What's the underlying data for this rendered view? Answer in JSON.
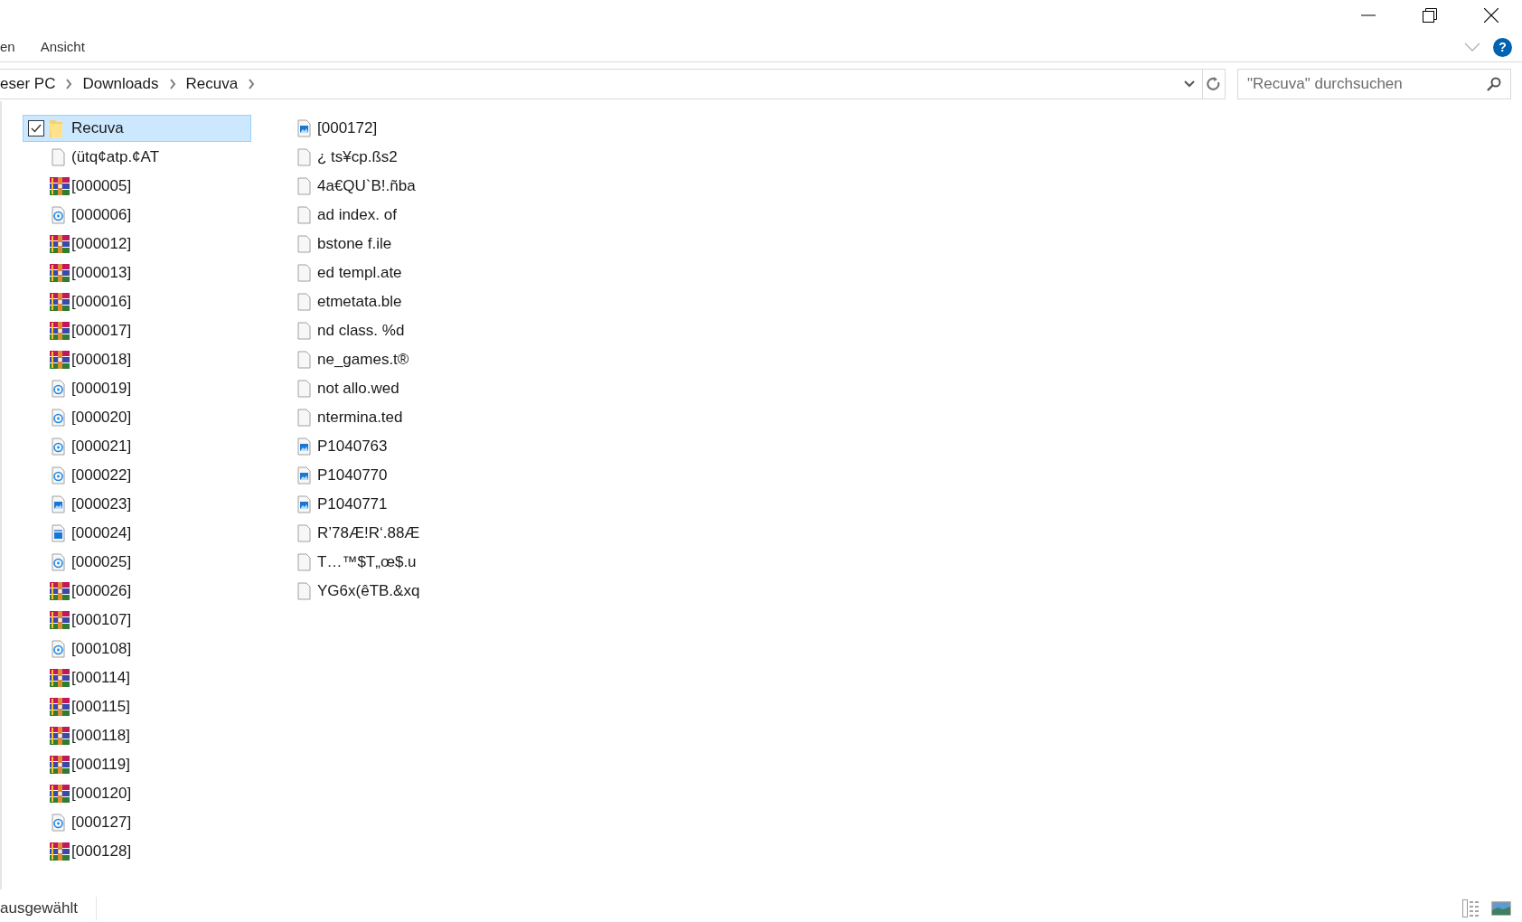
{
  "ribbon_tabs": [
    {
      "label": "en"
    },
    {
      "label": "Ansicht"
    }
  ],
  "help_button": {
    "label": "?"
  },
  "address_bar": {
    "breadcrumbs": [
      "eser PC",
      "Downloads",
      "Recuva"
    ]
  },
  "search": {
    "placeholder": "\"Recuva\" durchsuchen"
  },
  "items": [
    {
      "name": "Recuva",
      "kind": "folder",
      "selected": true,
      "checked": true
    },
    {
      "name": "(ütq¢atp.¢AT",
      "kind": "blank",
      "selected": false,
      "checked": false
    },
    {
      "name": "[000005]",
      "kind": "archive",
      "selected": false,
      "checked": false
    },
    {
      "name": "[000006]",
      "kind": "disc",
      "selected": false,
      "checked": false
    },
    {
      "name": "[000012]",
      "kind": "archive",
      "selected": false,
      "checked": false
    },
    {
      "name": "[000013]",
      "kind": "archive",
      "selected": false,
      "checked": false
    },
    {
      "name": "[000016]",
      "kind": "archive",
      "selected": false,
      "checked": false
    },
    {
      "name": "[000017]",
      "kind": "archive",
      "selected": false,
      "checked": false
    },
    {
      "name": "[000018]",
      "kind": "archive",
      "selected": false,
      "checked": false
    },
    {
      "name": "[000019]",
      "kind": "disc",
      "selected": false,
      "checked": false
    },
    {
      "name": "[000020]",
      "kind": "disc",
      "selected": false,
      "checked": false
    },
    {
      "name": "[000021]",
      "kind": "disc",
      "selected": false,
      "checked": false
    },
    {
      "name": "[000022]",
      "kind": "disc",
      "selected": false,
      "checked": false
    },
    {
      "name": "[000023]",
      "kind": "image",
      "selected": false,
      "checked": false
    },
    {
      "name": "[000024]",
      "kind": "video",
      "selected": false,
      "checked": false
    },
    {
      "name": "[000025]",
      "kind": "disc",
      "selected": false,
      "checked": false
    },
    {
      "name": "[000026]",
      "kind": "archive",
      "selected": false,
      "checked": false
    },
    {
      "name": "[000107]",
      "kind": "archive",
      "selected": false,
      "checked": false
    },
    {
      "name": "[000108]",
      "kind": "disc",
      "selected": false,
      "checked": false
    },
    {
      "name": "[000114]",
      "kind": "archive",
      "selected": false,
      "checked": false
    },
    {
      "name": "[000115]",
      "kind": "archive",
      "selected": false,
      "checked": false
    },
    {
      "name": "[000118]",
      "kind": "archive",
      "selected": false,
      "checked": false
    },
    {
      "name": "[000119]",
      "kind": "archive",
      "selected": false,
      "checked": false
    },
    {
      "name": "[000120]",
      "kind": "archive",
      "selected": false,
      "checked": false
    },
    {
      "name": "[000127]",
      "kind": "disc",
      "selected": false,
      "checked": false
    },
    {
      "name": "[000128]",
      "kind": "archive",
      "selected": false,
      "checked": false
    },
    {
      "name": "[000172]",
      "kind": "image",
      "selected": false,
      "checked": false
    },
    {
      "name": "¿ ts¥cp.ßs2",
      "kind": "blank",
      "selected": false,
      "checked": false
    },
    {
      "name": "4a€QU`B!.ñba",
      "kind": "blank",
      "selected": false,
      "checked": false
    },
    {
      "name": "ad index. of",
      "kind": "blank",
      "selected": false,
      "checked": false
    },
    {
      "name": "bstone f.ile",
      "kind": "blank",
      "selected": false,
      "checked": false
    },
    {
      "name": "ed templ.ate",
      "kind": "blank",
      "selected": false,
      "checked": false
    },
    {
      "name": "etmetata.ble",
      "kind": "blank",
      "selected": false,
      "checked": false
    },
    {
      "name": "nd class. %d",
      "kind": "blank",
      "selected": false,
      "checked": false
    },
    {
      "name": "ne_games.t®",
      "kind": "blank",
      "selected": false,
      "checked": false
    },
    {
      "name": "not allo.wed",
      "kind": "blank",
      "selected": false,
      "checked": false
    },
    {
      "name": "ntermina.ted",
      "kind": "blank",
      "selected": false,
      "checked": false
    },
    {
      "name": "P1040763",
      "kind": "image",
      "selected": false,
      "checked": false
    },
    {
      "name": "P1040770",
      "kind": "image",
      "selected": false,
      "checked": false
    },
    {
      "name": "P1040771",
      "kind": "image",
      "selected": false,
      "checked": false
    },
    {
      "name": "R’78Æ!R‘.88Æ",
      "kind": "blank",
      "selected": false,
      "checked": false
    },
    {
      "name": "T…™$T„œ$.u",
      "kind": "blank",
      "selected": false,
      "checked": false
    },
    {
      "name": "YG6x(êTB.&xq",
      "kind": "blank",
      "selected": false,
      "checked": false
    }
  ],
  "status_bar": {
    "text": "ausgewählt"
  }
}
